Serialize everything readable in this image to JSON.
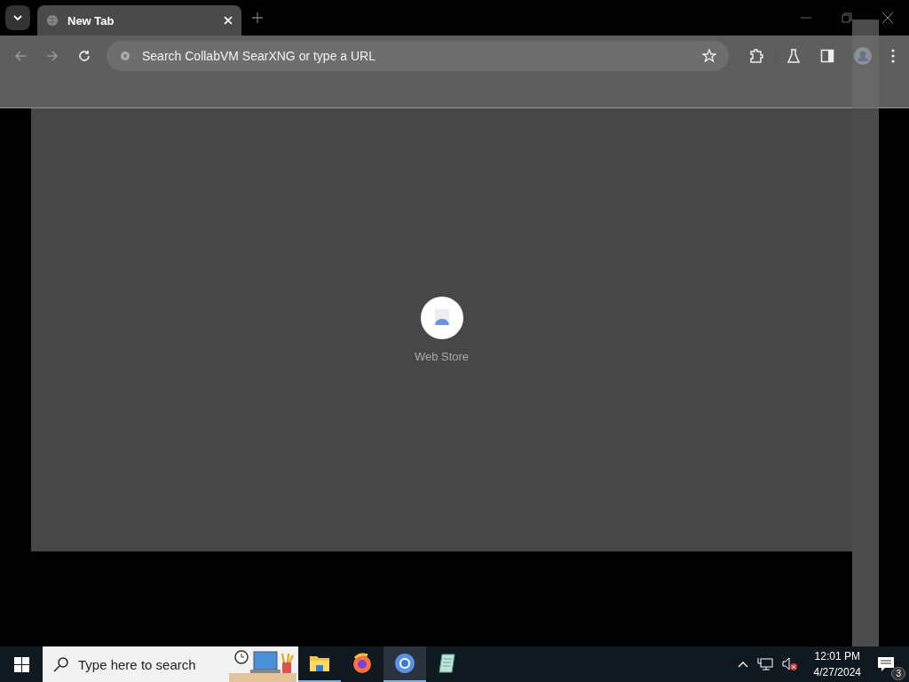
{
  "tabs": [
    {
      "label": "New Tab",
      "selected": true
    }
  ],
  "address_bar": {
    "placeholder": "Search CollabVM SearXNG or type a URL"
  },
  "shortcuts": [
    {
      "label": "Web Store"
    }
  ],
  "taskbar": {
    "search": {
      "placeholder": "Type here to search"
    },
    "apps": [
      {
        "kind": "folder",
        "running": true,
        "selected": false
      },
      {
        "kind": "firefox",
        "running": false,
        "selected": false
      },
      {
        "kind": "chrome",
        "running": true,
        "selected": true
      },
      {
        "kind": "notepad",
        "running": false,
        "selected": false
      }
    ],
    "volume_muted": true,
    "clock": {
      "time": "12:01 PM",
      "date": "4/27/2024"
    },
    "notifications": {
      "count": "3"
    }
  }
}
